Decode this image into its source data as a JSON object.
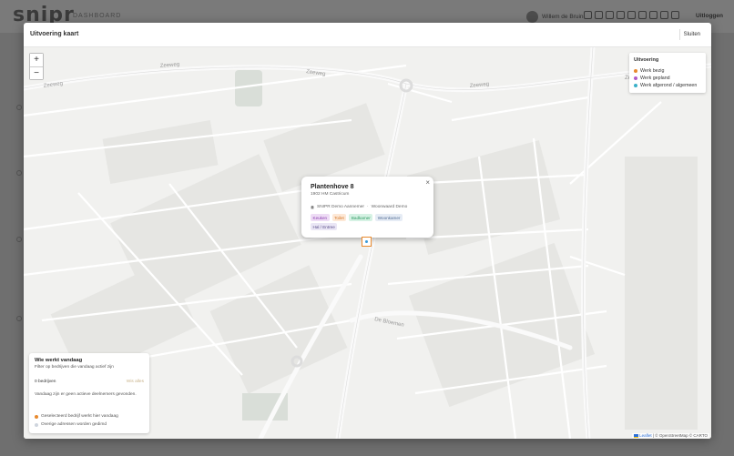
{
  "app": {
    "logo": "snipr",
    "section": "DASHBOARD",
    "user_name": "Willem de Bruin",
    "logout_label": "Uitloggen"
  },
  "modal": {
    "title": "Uitvoering kaart",
    "close_label": "Sluiten"
  },
  "map": {
    "zoom_in_label": "+",
    "zoom_out_label": "−",
    "street_labels": [
      "Zeeweg",
      "Zeeweg",
      "Zeeweg",
      "Zeeweg",
      "Zeeweg",
      "De Bloemen"
    ],
    "attribution_leaflet": "Leaflet",
    "attribution_rest": " | © OpenStreetMap © CARTO"
  },
  "legend": {
    "title": "Uitvoering",
    "items": [
      {
        "label": "Werk bezig",
        "color": "#e88a2e"
      },
      {
        "label": "Werk gepland",
        "color": "#b05bc9"
      },
      {
        "label": "Werk afgerond / algemeen",
        "color": "#3ab0c8"
      }
    ]
  },
  "popup": {
    "close_label": "×",
    "title": "Plantenhove 8",
    "subtitle": "1902 HM Castricum",
    "company": "SNIPR Demo Aannemer",
    "separator": "·",
    "client": "Woonwaard Demo",
    "tags": [
      {
        "label": "Keuken",
        "bg": "#eedcf5",
        "fg": "#8a3fb0"
      },
      {
        "label": "Toilet",
        "bg": "#fde8d6",
        "fg": "#d4782a"
      },
      {
        "label": "Badkamer",
        "bg": "#d6f2e4",
        "fg": "#2f9a63"
      },
      {
        "label": "Woonkamer",
        "bg": "#e6ecf5",
        "fg": "#4e6a92"
      },
      {
        "label": "Hal / Entree",
        "bg": "#eae6f5",
        "fg": "#5a4f8a"
      }
    ]
  },
  "panel": {
    "title": "Wie werkt vandaag",
    "subtitle": "Filter op bedrijven die vandaag actief zijn",
    "count": "0 bedrijven",
    "clear_label": "Wis alles",
    "empty_text": "Vandaag zijn er geen actieve deelnemers gevonden.",
    "legend": [
      {
        "label": "Geselecteerd bedrijf werkt hier vandaag",
        "color": "#e88a2e"
      },
      {
        "label": "Overige adressen worden gedimd",
        "color": "#cfd5de"
      }
    ]
  }
}
